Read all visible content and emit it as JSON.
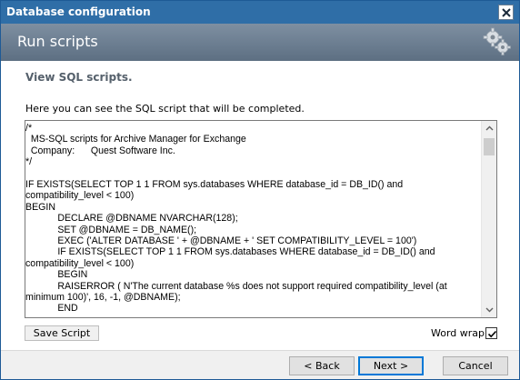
{
  "window": {
    "title": "Database configuration",
    "close_icon": "close-icon"
  },
  "banner": {
    "heading": "Run scripts",
    "icon": "gears-icon"
  },
  "content": {
    "subheading": "View SQL scripts.",
    "intro": "Here you can see the SQL script that will be completed.",
    "script_lines": [
      "/*",
      "  MS-SQL scripts for Archive Manager for Exchange",
      "  Company:      Quest Software Inc.",
      "*/",
      "",
      "IF EXISTS(SELECT TOP 1 1 FROM sys.databases WHERE database_id = DB_ID() and compatibility_level < 100)",
      "BEGIN",
      "\t\tDECLARE @DBNAME NVARCHAR(128);",
      "\t\tSET @DBNAME = DB_NAME();",
      "\t\tEXEC ('ALTER DATABASE ' + @DBNAME + ' SET COMPATIBILITY_LEVEL = 100')",
      "\t\tIF EXISTS(SELECT TOP 1 1 FROM sys.databases WHERE database_id = DB_ID() and compatibility_level < 100)",
      "\t\tBEGIN",
      "\t\tRAISERROR ( N'The current database %s does not support required compatibility_level (at minimum 100)', 16, -1, @DBNAME);",
      "\t\tEND"
    ],
    "save_button": "Save Script",
    "word_wrap_label": "Word wrap",
    "word_wrap_checked": true
  },
  "footer": {
    "back_button": "< Back",
    "next_button": "Next >",
    "cancel_button": "Cancel"
  }
}
